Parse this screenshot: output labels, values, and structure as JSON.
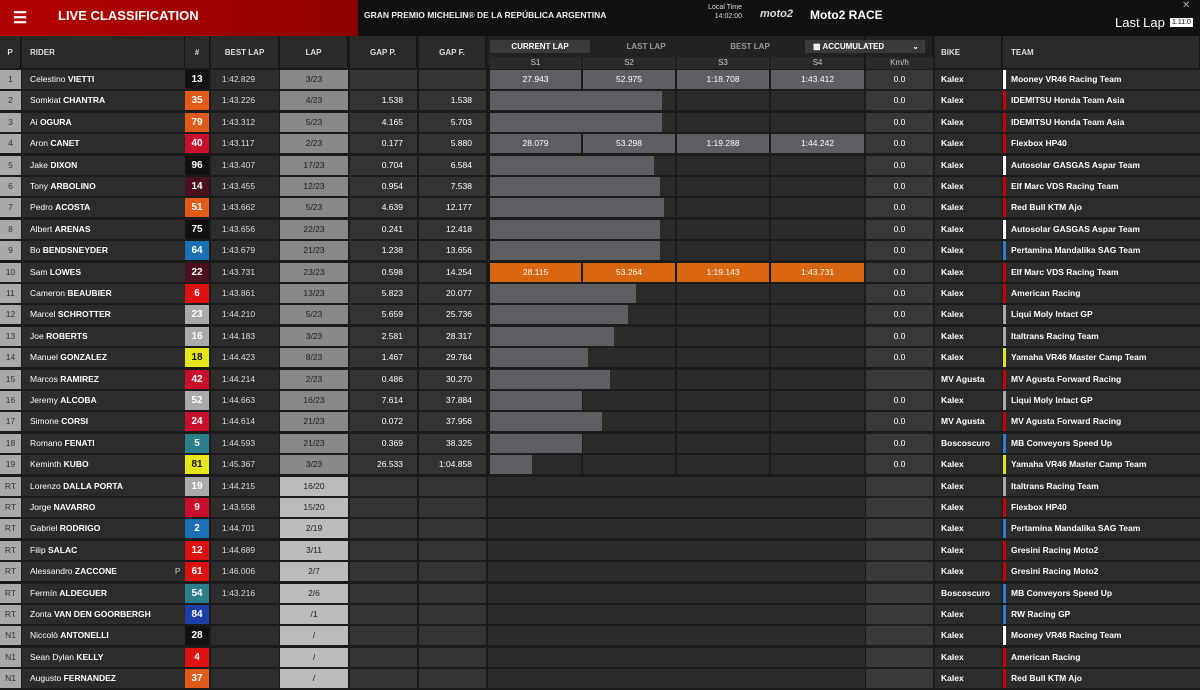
{
  "header": {
    "title": "LIVE CLASSIFICATION",
    "gp": "GRAN PREMIO MICHELIN® DE LA REPÚBLICA ARGENTINA",
    "local_time_label": "Local Time",
    "local_time": "14:02:00",
    "logo": "moto2",
    "race": "Moto2 RACE",
    "last_lap": "Last Lap",
    "version": "1.11.0"
  },
  "columns": {
    "p": "P",
    "rider": "RIDER",
    "num": "#",
    "best": "BEST LAP",
    "lap": "LAP",
    "gapp": "GAP P.",
    "gapf": "GAP F.",
    "bike": "BIKE",
    "team": "TEAM",
    "kmh": "Km/h"
  },
  "tabs": {
    "current": "CURRENT LAP",
    "last": "LAST LAP",
    "best": "BEST LAP",
    "accum": "ACCUMULATED"
  },
  "sectors": [
    "S1",
    "S2",
    "S3",
    "S4"
  ],
  "colors": {
    "highlight": "#d86510",
    "bar": "#5d5f63"
  },
  "riders": [
    {
      "pos": "1",
      "first": "Celestino",
      "last": "VIETTI",
      "num": "13",
      "numbg": "#111",
      "best": "1:42.829",
      "lap": "3/23",
      "gapp": "",
      "gapf": "",
      "s": [
        "27.943",
        "52.975",
        "1:18.708",
        "1:43.412"
      ],
      "kmh": "0.0",
      "bike": "Kalex",
      "team": "Mooney VR46 Racing Team",
      "tc": "#fff",
      "bar": 0
    },
    {
      "pos": "2",
      "first": "Somkiat",
      "last": "CHANTRA",
      "num": "35",
      "numbg": "#e05a1a",
      "best": "1:43.226",
      "lap": "4/23",
      "gapp": "1.538",
      "gapf": "1.538",
      "kmh": "0.0",
      "bike": "Kalex",
      "team": "IDEMITSU Honda Team Asia",
      "tc": "#c00",
      "bar": 172
    },
    {
      "pos": "3",
      "first": "Ai",
      "last": "OGURA",
      "num": "79",
      "numbg": "#e05a1a",
      "best": "1:43.312",
      "lap": "5/23",
      "gapp": "4.165",
      "gapf": "5.703",
      "kmh": "0.0",
      "bike": "Kalex",
      "team": "IDEMITSU Honda Team Asia",
      "tc": "#c00",
      "bar": 172
    },
    {
      "pos": "4",
      "first": "Aron",
      "last": "CANET",
      "num": "40",
      "numbg": "#c8102e",
      "best": "1:43.117",
      "lap": "2/23",
      "gapp": "0.177",
      "gapf": "5.880",
      "s": [
        "28.079",
        "53.298",
        "1:19.288",
        "1:44.242"
      ],
      "kmh": "0.0",
      "bike": "Kalex",
      "team": "Flexbox HP40",
      "tc": "#c00",
      "bar": 0
    },
    {
      "pos": "5",
      "first": "Jake",
      "last": "DIXON",
      "num": "96",
      "numbg": "#111",
      "best": "1:43.407",
      "lap": "17/23",
      "gapp": "0.704",
      "gapf": "6.584",
      "kmh": "0.0",
      "bike": "Kalex",
      "team": "Autosolar GASGAS Aspar Team",
      "tc": "#fff",
      "bar": 164
    },
    {
      "pos": "6",
      "first": "Tony",
      "last": "ARBOLINO",
      "num": "14",
      "numbg": "#4a1020",
      "best": "1:43.455",
      "lap": "12/23",
      "gapp": "0.954",
      "gapf": "7.538",
      "kmh": "0.0",
      "bike": "Kalex",
      "team": "Elf Marc VDS Racing Team",
      "tc": "#c00",
      "bar": 170
    },
    {
      "pos": "7",
      "first": "Pedro",
      "last": "ACOSTA",
      "num": "51",
      "numbg": "#e05a1a",
      "best": "1:43.662",
      "lap": "5/23",
      "gapp": "4.639",
      "gapf": "12.177",
      "kmh": "0.0",
      "bike": "Kalex",
      "team": "Red Bull KTM Ajo",
      "tc": "#c00",
      "bar": 174
    },
    {
      "pos": "8",
      "first": "Albert",
      "last": "ARENAS",
      "num": "75",
      "numbg": "#111",
      "best": "1:43.656",
      "lap": "22/23",
      "gapp": "0.241",
      "gapf": "12.418",
      "kmh": "0.0",
      "bike": "Kalex",
      "team": "Autosolar GASGAS Aspar Team",
      "tc": "#fff",
      "bar": 170
    },
    {
      "pos": "9",
      "first": "Bo",
      "last": "BENDSNEYDER",
      "num": "64",
      "numbg": "#1b6fb5",
      "best": "1:43.679",
      "lap": "21/23",
      "gapp": "1.238",
      "gapf": "13.656",
      "kmh": "0.0",
      "bike": "Kalex",
      "team": "Pertamina Mandalika SAG Team",
      "tc": "#2a7fd0",
      "bar": 170
    },
    {
      "pos": "10",
      "first": "Sam",
      "last": "LOWES",
      "num": "22",
      "numbg": "#4a1020",
      "best": "1:43.731",
      "lap": "23/23",
      "gapp": "0.598",
      "gapf": "14.254",
      "s": [
        "28.115",
        "53.264",
        "1:19.143",
        "1:43.731"
      ],
      "kmh": "0.0",
      "bike": "Kalex",
      "team": "Elf Marc VDS Racing Team",
      "tc": "#c00",
      "bar": 0,
      "hl": true
    },
    {
      "pos": "11",
      "first": "Cameron",
      "last": "BEAUBIER",
      "num": "6",
      "numbg": "#d11",
      "best": "1:43.861",
      "lap": "13/23",
      "gapp": "5.823",
      "gapf": "20.077",
      "kmh": "0.0",
      "bike": "Kalex",
      "team": "American Racing",
      "tc": "#c00",
      "bar": 146
    },
    {
      "pos": "12",
      "first": "Marcel",
      "last": "SCHROTTER",
      "num": "23",
      "numbg": "#aaa",
      "best": "1:44.210",
      "lap": "5/23",
      "gapp": "5.659",
      "gapf": "25.736",
      "kmh": "0.0",
      "bike": "Kalex",
      "team": "Liqui Moly Intact GP",
      "tc": "#aaa",
      "bar": 138
    },
    {
      "pos": "13",
      "first": "Joe",
      "last": "ROBERTS",
      "num": "16",
      "numbg": "#aaa",
      "best": "1:44.183",
      "lap": "3/23",
      "gapp": "2.581",
      "gapf": "28.317",
      "kmh": "0.0",
      "bike": "Kalex",
      "team": "Italtrans Racing Team",
      "tc": "#aaa",
      "bar": 124
    },
    {
      "pos": "14",
      "first": "Manuel",
      "last": "GONZALEZ",
      "num": "18",
      "numbg": "#e6e61a",
      "best": "1:44.423",
      "lap": "8/23",
      "gapp": "1.467",
      "gapf": "29.784",
      "kmh": "0.0",
      "bike": "Kalex",
      "team": "Yamaha VR46 Master Camp Team",
      "tc": "#e6e61a",
      "bar": 98
    },
    {
      "pos": "15",
      "first": "Marcos",
      "last": "RAMIREZ",
      "num": "42",
      "numbg": "#c8102e",
      "best": "1:44.214",
      "lap": "2/23",
      "gapp": "0.486",
      "gapf": "30.270",
      "kmh": "",
      "bike": "MV Agusta",
      "team": "MV Agusta Forward Racing",
      "tc": "#c00",
      "bar": 120
    },
    {
      "pos": "16",
      "first": "Jeremy",
      "last": "ALCOBA",
      "num": "52",
      "numbg": "#aaa",
      "best": "1:44.663",
      "lap": "16/23",
      "gapp": "7.614",
      "gapf": "37.884",
      "kmh": "0.0",
      "bike": "Kalex",
      "team": "Liqui Moly Intact GP",
      "tc": "#aaa",
      "bar": 92
    },
    {
      "pos": "17",
      "first": "Simone",
      "last": "CORSI",
      "num": "24",
      "numbg": "#c8102e",
      "best": "1:44.614",
      "lap": "21/23",
      "gapp": "0.072",
      "gapf": "37.956",
      "kmh": "0.0",
      "bike": "MV Agusta",
      "team": "MV Agusta Forward Racing",
      "tc": "#c00",
      "bar": 112
    },
    {
      "pos": "18",
      "first": "Romano",
      "last": "FENATI",
      "num": "5",
      "numbg": "#2a7f8a",
      "best": "1:44.593",
      "lap": "21/23",
      "gapp": "0.369",
      "gapf": "38.325",
      "kmh": "0.0",
      "bike": "Boscoscuro",
      "team": "MB Conveyors Speed Up",
      "tc": "#2a7fd0",
      "bar": 92
    },
    {
      "pos": "19",
      "first": "Keminth",
      "last": "KUBO",
      "num": "81",
      "numbg": "#e6e61a",
      "best": "1:45.367",
      "lap": "3/23",
      "gapp": "26.533",
      "gapf": "1:04.858",
      "kmh": "0.0",
      "bike": "Kalex",
      "team": "Yamaha VR46 Master Camp Team",
      "tc": "#e6e61a",
      "bar": 42
    },
    {
      "pos": "RT",
      "first": "Lorenzo",
      "last": "DALLA PORTA",
      "num": "19",
      "numbg": "#aaa",
      "best": "1:44.215",
      "lap": "16/20",
      "gapp": "",
      "gapf": "",
      "kmh": "",
      "bike": "Kalex",
      "team": "Italtrans Racing Team",
      "tc": "#aaa",
      "bar": 0,
      "out": true
    },
    {
      "pos": "RT",
      "first": "Jorge",
      "last": "NAVARRO",
      "num": "9",
      "numbg": "#c8102e",
      "best": "1:43.558",
      "lap": "15/20",
      "gapp": "",
      "gapf": "",
      "kmh": "",
      "bike": "Kalex",
      "team": "Flexbox HP40",
      "tc": "#c00",
      "bar": 0,
      "out": true
    },
    {
      "pos": "RT",
      "first": "Gabriel",
      "last": "RODRIGO",
      "num": "2",
      "numbg": "#1b6fb5",
      "best": "1:44.701",
      "lap": "2/19",
      "gapp": "",
      "gapf": "",
      "kmh": "",
      "bike": "Kalex",
      "team": "Pertamina Mandalika SAG Team",
      "tc": "#2a7fd0",
      "bar": 0,
      "out": true
    },
    {
      "pos": "RT",
      "first": "Filip",
      "last": "SALAC",
      "num": "12",
      "numbg": "#d11",
      "best": "1:44.689",
      "lap": "3/11",
      "gapp": "",
      "gapf": "",
      "kmh": "",
      "bike": "Kalex",
      "team": "Gresini Racing Moto2",
      "tc": "#c00",
      "bar": 0,
      "out": true
    },
    {
      "pos": "RT",
      "first": "Alessandro",
      "last": "ZACCONE",
      "num": "61",
      "numbg": "#d11",
      "best": "1:46.006",
      "lap": "2/7",
      "gapp": "",
      "gapf": "",
      "kmh": "",
      "bike": "Kalex",
      "team": "Gresini Racing Moto2",
      "tc": "#c00",
      "bar": 0,
      "out": true,
      "flag": "P"
    },
    {
      "pos": "RT",
      "first": "Fermín",
      "last": "ALDEGUER",
      "num": "54",
      "numbg": "#2a7f8a",
      "best": "1:43.216",
      "lap": "2/6",
      "gapp": "",
      "gapf": "",
      "kmh": "",
      "bike": "Boscoscuro",
      "team": "MB Conveyors Speed Up",
      "tc": "#2a7fd0",
      "bar": 0,
      "out": true
    },
    {
      "pos": "RT",
      "first": "Zonta",
      "last": "VAN DEN GOORBERGH",
      "num": "84",
      "numbg": "#1b3fa5",
      "best": "",
      "lap": "/1",
      "gapp": "",
      "gapf": "",
      "kmh": "",
      "bike": "Kalex",
      "team": "RW Racing GP",
      "tc": "#2a7fd0",
      "bar": 0,
      "out": true
    },
    {
      "pos": "N1",
      "first": "Niccolò",
      "last": "ANTONELLI",
      "num": "28",
      "numbg": "#111",
      "best": "",
      "lap": "/",
      "gapp": "",
      "gapf": "",
      "kmh": "",
      "bike": "Kalex",
      "team": "Mooney VR46 Racing Team",
      "tc": "#fff",
      "bar": 0,
      "out": true
    },
    {
      "pos": "N1",
      "first": "Sean Dylan",
      "last": "KELLY",
      "num": "4",
      "numbg": "#d11",
      "best": "",
      "lap": "/",
      "gapp": "",
      "gapf": "",
      "kmh": "",
      "bike": "Kalex",
      "team": "American Racing",
      "tc": "#c00",
      "bar": 0,
      "out": true
    },
    {
      "pos": "N1",
      "first": "Augusto",
      "last": "FERNANDEZ",
      "num": "37",
      "numbg": "#e05a1a",
      "best": "",
      "lap": "/",
      "gapp": "",
      "gapf": "",
      "kmh": "",
      "bike": "Kalex",
      "team": "Red Bull KTM Ajo",
      "tc": "#c00",
      "bar": 0,
      "out": true
    }
  ]
}
